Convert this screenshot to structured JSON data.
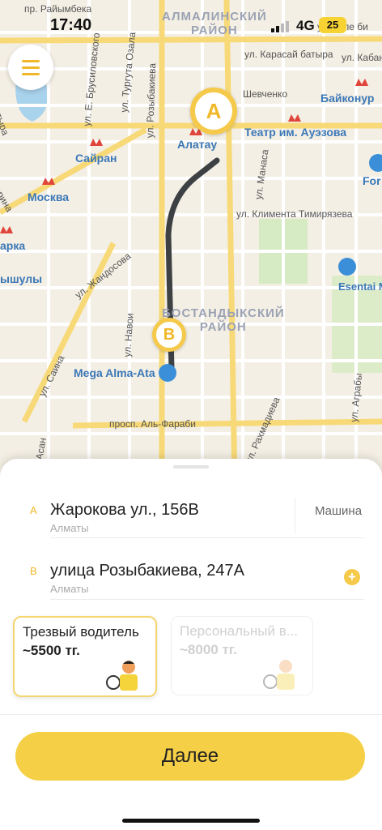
{
  "status_bar": {
    "time": "17:40",
    "network": "4G",
    "battery": "25"
  },
  "map": {
    "districts": [
      "АЛМАЛИНСКИЙ\nРАЙОН",
      "БОСТАНДЫКСКИЙ\nРАЙОН"
    ],
    "streets": [
      "пр. Райымбека",
      "ул. Толе би",
      "ул. Карасай батыра",
      "ул. Кабанбай",
      "Шевченко",
      "ул. Е. Брусиловского",
      "ул. Тургута Озала",
      "ул. Розыбакиева",
      "ул. Манаса",
      "ул. Климента Тимирязева",
      "ул. Жандосова",
      "ул. Навои",
      "ул. Саина",
      "просп. Аль-Фараби",
      "ул. Рахмадиева",
      "ул. Аграбы",
      "ул. Асан",
      "батыра",
      "арина"
    ],
    "metro_stations": [
      "Алатау",
      "Сайран",
      "Москва",
      "Байконур",
      "Театр им. Ауэзова",
      "арка",
      "ышулы"
    ],
    "places": [
      "Mega Alma-Ata",
      "Esentai Mall",
      "For"
    ],
    "marker_a": "A",
    "marker_b": "B"
  },
  "route": {
    "from": {
      "letter": "A",
      "address": "Жарокова ул., 156В",
      "city": "Алматы",
      "side": "Машина"
    },
    "to": {
      "letter": "B",
      "address": "улица Розыбакиева, 247А",
      "city": "Алматы"
    }
  },
  "tariffs": [
    {
      "name": "Трезвый водитель",
      "price": "~5500 тг.",
      "selected": true
    },
    {
      "name": "Персональный в...",
      "price": "~8000 тг.",
      "selected": false
    }
  ],
  "next_button": "Далее",
  "colors": {
    "accent": "#f5cf45",
    "route": "#3d4144",
    "metro": "#e0453b"
  }
}
